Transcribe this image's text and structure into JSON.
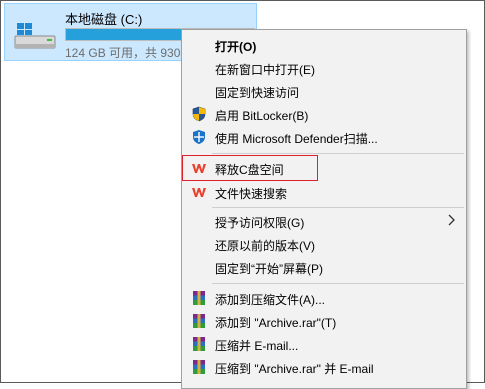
{
  "drive": {
    "name": "本地磁盘 (C:)",
    "size_text": "124 GB 可用，共 930 GB",
    "used_fraction": 0.87,
    "icon": "hard-drive-icon"
  },
  "menu": {
    "items": [
      {
        "label": "打开(O)"
      },
      {
        "label": "在新窗口中打开(E)"
      },
      {
        "label": "固定到快速访问"
      },
      {
        "label": "启用 BitLocker(B)",
        "icon": "shield-icon"
      },
      {
        "label": "使用 Microsoft Defender扫描...",
        "icon": "defender-icon"
      },
      {
        "label": "释放C盘空间",
        "icon": "wps-icon"
      },
      {
        "label": "文件快速搜索",
        "icon": "wps-icon"
      },
      {
        "label": "授予访问权限(G)"
      },
      {
        "label": "还原以前的版本(V)"
      },
      {
        "label": "固定到“开始”屏幕(P)"
      },
      {
        "label": "添加到压缩文件(A)...",
        "icon": "winrar-icon"
      },
      {
        "label": "添加到 \"Archive.rar\"(T)",
        "icon": "winrar-icon"
      },
      {
        "label": "压缩并 E-mail...",
        "icon": "winrar-icon"
      },
      {
        "label": "压缩到 \"Archive.rar\" 并 E-mail",
        "icon": "winrar-icon"
      }
    ]
  },
  "colors": {
    "selection_bg": "#cce8ff",
    "bar_fill": "#26a0da",
    "highlight_border": "#e0212b",
    "wps_red": "#e8412c"
  }
}
